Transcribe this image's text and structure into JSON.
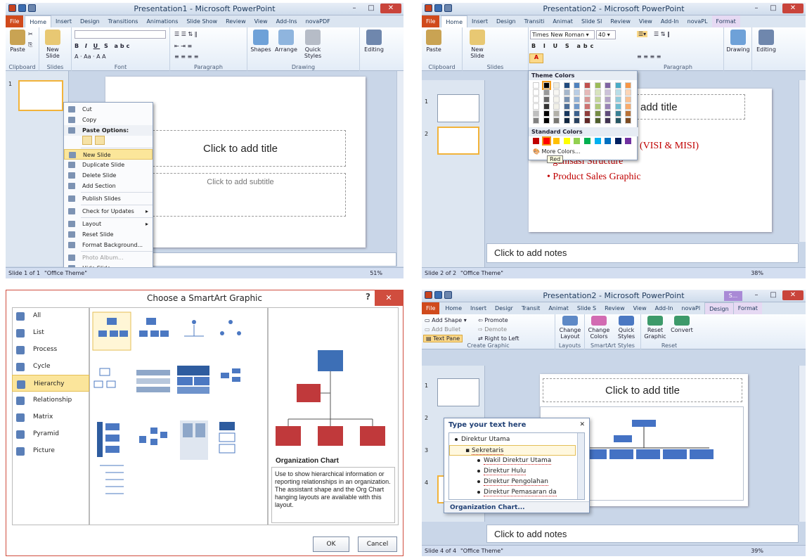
{
  "p1": {
    "title": "Presentation1 - Microsoft PowerPoint",
    "tabs": [
      "File",
      "Home",
      "Insert",
      "Design",
      "Transitions",
      "Animations",
      "Slide Show",
      "Review",
      "View",
      "Add-Ins",
      "novaPDF"
    ],
    "groups": {
      "clipboard": "Clipboard",
      "slides": "Slides",
      "font": "Font",
      "paragraph": "Paragraph",
      "drawing": "Drawing"
    },
    "buttons": {
      "paste": "Paste",
      "new_slide": "New Slide",
      "shapes": "Shapes",
      "arrange": "Arrange",
      "quick_styles": "Quick Styles",
      "editing": "Editing"
    },
    "thumb_number": "1",
    "slide_title": "Click to add title",
    "slide_subtitle": "Click to add subtitle",
    "status": {
      "slide": "Slide 1 of 1",
      "theme": "\"Office Theme\"",
      "zoom": "51%"
    },
    "context_menu": [
      {
        "label": "Cut",
        "name": "cut"
      },
      {
        "label": "Copy",
        "name": "copy"
      },
      {
        "label": "Paste Options:",
        "name": "paste-options",
        "header": true
      },
      {
        "label": "New Slide",
        "name": "new-slide",
        "highlight": true
      },
      {
        "label": "Duplicate Slide",
        "name": "duplicate-slide"
      },
      {
        "label": "Delete Slide",
        "name": "delete-slide"
      },
      {
        "label": "Add Section",
        "name": "add-section"
      },
      {
        "label": "Publish Slides",
        "name": "publish-slides"
      },
      {
        "label": "Check for Updates",
        "name": "check-for-updates",
        "submenu": true
      },
      {
        "label": "Layout",
        "name": "layout",
        "submenu": true
      },
      {
        "label": "Reset Slide",
        "name": "reset-slide"
      },
      {
        "label": "Format Background...",
        "name": "format-background"
      },
      {
        "label": "Photo Album...",
        "name": "photo-album",
        "disabled": true
      },
      {
        "label": "Hide Slide",
        "name": "hide-slide"
      }
    ]
  },
  "p2": {
    "title": "Presentation2 - Microsoft PowerPoint",
    "tabs": [
      "File",
      "Home",
      "Insert",
      "Design",
      "Transiti",
      "Animat",
      "Slide Sl",
      "Review",
      "View",
      "Add-In",
      "novaPL",
      "Format"
    ],
    "font_name": "Times New Roman",
    "font_size": "40",
    "groups": {
      "clipboard": "Clipboard",
      "slides": "Slides",
      "paragraph": "Paragraph"
    },
    "buttons": {
      "paste": "Paste",
      "new_slide": "New Slide",
      "drawing": "Drawing",
      "editing": "Editing"
    },
    "theme_colors_label": "Theme Colors",
    "standard_colors_label": "Standard Colors",
    "more_colors": "More Colors...",
    "tooltip": "Red",
    "thumb_numbers": [
      "1",
      "2"
    ],
    "slide_title": "add title",
    "bullets": [
      "(VISI & MISI)",
      "ganisasi Structure",
      "Product Sales Graphic"
    ],
    "notes": "Click to add notes",
    "status": {
      "slide": "Slide 2 of 2",
      "theme": "\"Office Theme\"",
      "zoom": "38%"
    },
    "colors": {
      "theme_top": [
        "#ffffff",
        "#000000",
        "#eeece1",
        "#1f497d",
        "#4f81bd",
        "#c0504d",
        "#9bbb59",
        "#8064a2",
        "#4bacc6",
        "#f79646"
      ],
      "standard": [
        "#c00000",
        "#ff0000",
        "#ffc000",
        "#ffff00",
        "#92d050",
        "#00b050",
        "#00b0f0",
        "#0070c0",
        "#002060",
        "#7030a0"
      ]
    }
  },
  "p3": {
    "title": "Choose a SmartArt Graphic",
    "help": "?",
    "categories": [
      {
        "label": "All",
        "name": "all"
      },
      {
        "label": "List",
        "name": "list"
      },
      {
        "label": "Process",
        "name": "process"
      },
      {
        "label": "Cycle",
        "name": "cycle"
      },
      {
        "label": "Hierarchy",
        "name": "hierarchy",
        "selected": true
      },
      {
        "label": "Relationship",
        "name": "relationship"
      },
      {
        "label": "Matrix",
        "name": "matrix"
      },
      {
        "label": "Pyramid",
        "name": "pyramid"
      },
      {
        "label": "Picture",
        "name": "picture"
      }
    ],
    "preview_title": "Organization Chart",
    "description": "Use to show hierarchical information or reporting relationships in an organization. The assistant shape and the Org Chart hanging layouts are available with this layout.",
    "ok": "OK",
    "cancel": "Cancel"
  },
  "p4": {
    "title": "Presentation2 - Microsoft PowerPoint",
    "ctx_tab": "S...",
    "tabs": [
      "File",
      "Home",
      "Insert",
      "Desigr",
      "Transit",
      "Animat",
      "Slide S",
      "Review",
      "View",
      "Add-In",
      "novaPl",
      "Design",
      "Format"
    ],
    "create": {
      "add_shape": "Add Shape",
      "add_bullet": "Add Bullet",
      "text_pane": "Text Pane",
      "promote": "Promote",
      "demote": "Demote",
      "rtl": "Right to Left"
    },
    "buttons": {
      "change_layout": "Change Layout",
      "change_colors": "Change Colors",
      "quick_styles": "Quick Styles",
      "reset_graphic": "Reset Graphic",
      "convert": "Convert"
    },
    "groups": {
      "create_graphic": "Create Graphic",
      "layouts": "Layouts",
      "smartart_styles": "SmartArt Styles",
      "reset": "Reset"
    },
    "thumb_numbers": [
      "1",
      "2",
      "3",
      "4"
    ],
    "slide_title": "Click to add title",
    "text_pane_title": "Type your text here",
    "text_items": [
      "Direktur Utama",
      "Sekretaris",
      "Wakil Direktur Utama",
      "Direktur Hulu",
      "Direktur Pengolahan",
      "Direktur Pemasaran da"
    ],
    "text_pane_footer": "Organization Chart...",
    "notes": "Click to add notes",
    "status": {
      "slide": "Slide 4 of 4",
      "theme": "\"Office Theme\"",
      "zoom": "39%"
    }
  }
}
